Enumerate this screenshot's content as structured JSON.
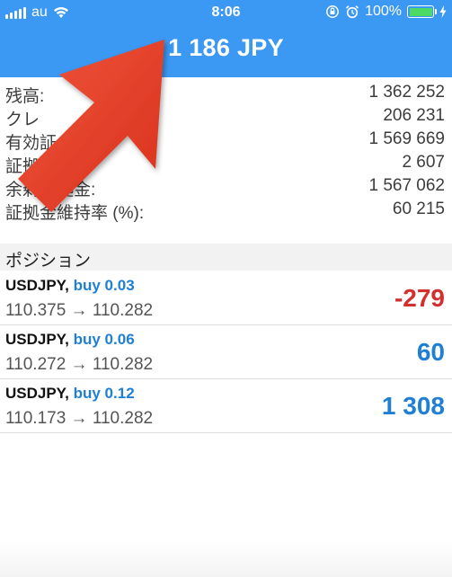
{
  "status_bar": {
    "carrier": "au",
    "time": "8:06",
    "battery": "100%"
  },
  "header": {
    "balance": "1 186 JPY",
    "background_color": "#3b98f3"
  },
  "summary": [
    {
      "label": "残高:",
      "value": "1 362 252"
    },
    {
      "label": "クレ",
      "value": "206 231"
    },
    {
      "label": "有効証",
      "value": "1 569 669"
    },
    {
      "label": "証拠金:",
      "value": "2 607"
    },
    {
      "label": "余剰証拠金:",
      "value": "1 567 062"
    },
    {
      "label": "証拠金維持率 (%):",
      "value": "60 215"
    }
  ],
  "positions_section": {
    "title": "ポジション"
  },
  "positions": [
    {
      "symbol": "USDJPY,",
      "side": "buy 0.03",
      "prices": "110.375 → 110.282",
      "profit": "-279",
      "profit_color": "#d32f2f"
    },
    {
      "symbol": "USDJPY,",
      "side": "buy 0.06",
      "prices": "110.272 → 110.282",
      "profit": "60",
      "profit_color": "#1f7fd4"
    },
    {
      "symbol": "USDJPY,",
      "side": "buy 0.12",
      "prices": "110.173 → 110.282",
      "profit": "1 308",
      "profit_color": "#1f7fd4"
    }
  ],
  "colors": {
    "buy": "#1f7fd4",
    "loss": "#d32f2f",
    "profit": "#1f7fd4",
    "annotation_arrow": "#e8412a"
  },
  "icons": [
    "signal-icon",
    "wifi-icon",
    "orientation-lock-icon",
    "alarm-icon",
    "battery-icon",
    "charging-icon",
    "annotation-arrow-icon"
  ]
}
